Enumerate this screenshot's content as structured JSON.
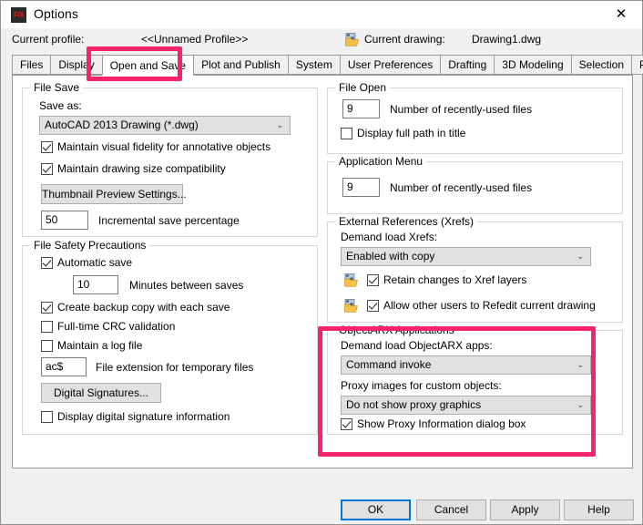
{
  "window": {
    "title": "Options",
    "app_icon": "F/X",
    "close_icon": "✕"
  },
  "header": {
    "current_profile_label": "Current profile:",
    "current_profile_value": "<<Unnamed Profile>>",
    "current_drawing_label": "Current drawing:",
    "current_drawing_value": "Drawing1.dwg"
  },
  "tabs": [
    {
      "label": "Files",
      "selected": false
    },
    {
      "label": "Display",
      "selected": false
    },
    {
      "label": "Open and Save",
      "selected": true
    },
    {
      "label": "Plot and Publish",
      "selected": false
    },
    {
      "label": "System",
      "selected": false
    },
    {
      "label": "User Preferences",
      "selected": false
    },
    {
      "label": "Drafting",
      "selected": false
    },
    {
      "label": "3D Modeling",
      "selected": false
    },
    {
      "label": "Selection",
      "selected": false
    },
    {
      "label": "Profiles",
      "selected": false
    }
  ],
  "file_save": {
    "title": "File Save",
    "save_as_label": "Save as:",
    "save_as_value": "AutoCAD 2013 Drawing (*.dwg)",
    "maintain_visual_fidelity_label": "Maintain visual fidelity for annotative objects",
    "maintain_visual_fidelity_checked": true,
    "maintain_drawing_size_label": "Maintain drawing size compatibility",
    "maintain_drawing_size_checked": true,
    "thumbnail_button_label": "Thumbnail Preview Settings...",
    "incremental_save_value": "50",
    "incremental_save_label": "Incremental save percentage"
  },
  "file_safety": {
    "title": "File Safety Precautions",
    "automatic_save_label": "Automatic save",
    "automatic_save_checked": true,
    "minutes_value": "10",
    "minutes_label": "Minutes between saves",
    "create_backup_label": "Create backup copy with each save",
    "create_backup_checked": true,
    "crc_label": "Full-time CRC validation",
    "crc_checked": false,
    "log_file_label": "Maintain a log file",
    "log_file_checked": false,
    "temp_ext_value": "ac$",
    "temp_ext_label": "File extension for temporary files",
    "digital_signatures_button": "Digital Signatures...",
    "display_signature_label": "Display digital signature information",
    "display_signature_checked": false
  },
  "file_open": {
    "title": "File Open",
    "recent_files_value": "9",
    "recent_files_label": "Number of recently-used files",
    "full_path_label": "Display full path in title",
    "full_path_checked": false
  },
  "application_menu": {
    "title": "Application Menu",
    "recent_files_value": "9",
    "recent_files_label": "Number of recently-used files"
  },
  "xrefs": {
    "title": "External References (Xrefs)",
    "demand_load_label": "Demand load Xrefs:",
    "demand_load_value": "Enabled with copy",
    "retain_changes_label": "Retain changes to Xref layers",
    "retain_changes_checked": true,
    "allow_refedit_label": "Allow other users to Refedit current drawing",
    "allow_refedit_checked": true
  },
  "objectarx": {
    "title": "ObjectARX Applications",
    "demand_load_label": "Demand load ObjectARX apps:",
    "demand_load_value": "Command invoke",
    "proxy_images_label": "Proxy images for custom objects:",
    "proxy_images_value": "Do not show proxy graphics",
    "show_proxy_label": "Show Proxy Information dialog box",
    "show_proxy_checked": true
  },
  "footer": {
    "ok_label": "OK",
    "cancel_label": "Cancel",
    "apply_label": "Apply",
    "help_label": "Help"
  },
  "annotations": {
    "highlight_color": "#f6246b",
    "accent_color": "#0078d7"
  },
  "icons": {
    "dropdown_arrow": "⌄"
  }
}
